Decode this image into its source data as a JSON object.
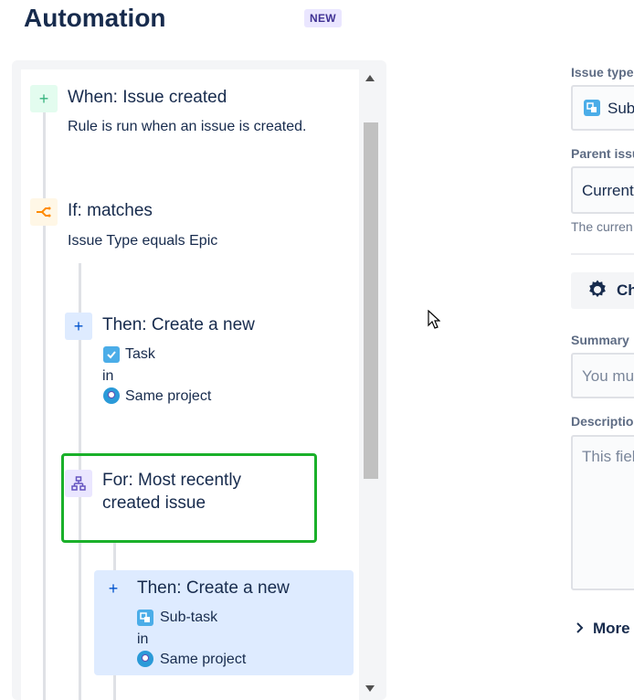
{
  "header": {
    "title": "Automation",
    "badge": "NEW"
  },
  "rule": {
    "trigger": {
      "title": "When: Issue created",
      "description": "Rule is run when an issue is created.",
      "icon": "plus-icon",
      "color": "#36b37e"
    },
    "condition": {
      "title": "If: matches",
      "description": "Issue Type equals Epic",
      "icon": "branch-icon",
      "color": "#ff8b00"
    },
    "action1": {
      "title": "Then: Create a new",
      "issue_type": "Task",
      "in_label": "in",
      "project": "Same project",
      "icon": "plus-icon"
    },
    "branch": {
      "title_line1": "For: Most recently",
      "title_line2": "created issue",
      "icon": "hierarchy-icon"
    },
    "action2": {
      "title": "Then: Create a new",
      "issue_type": "Sub-task",
      "in_label": "in",
      "project": "Same project",
      "icon": "plus-icon"
    }
  },
  "config": {
    "issue_type_label": "Issue type",
    "issue_type_value": "Sub",
    "parent_issue_label": "Parent issu",
    "parent_issue_value": "Current",
    "parent_helper": "The curren",
    "choose_button": "Ch",
    "summary_label": "Summary",
    "summary_placeholder": "You mus",
    "description_label": "Descriptio",
    "description_placeholder": "This fiel",
    "more_label": "More"
  },
  "colors": {
    "highlight": "#1ab02a",
    "selected": "#deebff",
    "accent": "#0052cc"
  }
}
